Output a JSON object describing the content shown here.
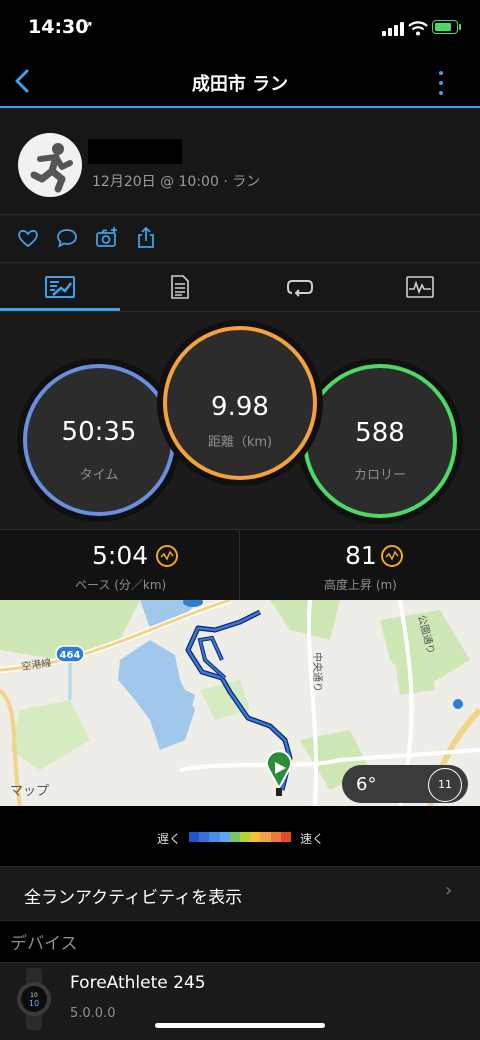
{
  "status": {
    "time": "14:30",
    "battery_pct": 0.85
  },
  "nav": {
    "title": "成田市 ラン"
  },
  "activity": {
    "meta": "12月20日 @ 10:00 · ラン",
    "icons": [
      "heart-icon",
      "comment-icon",
      "camera-add-icon",
      "share-icon"
    ]
  },
  "tabs": [
    "overview-tab-icon",
    "details-tab-icon",
    "laps-tab-icon",
    "charts-tab-icon"
  ],
  "rings": {
    "time": {
      "value": "50:35",
      "label": "タイム",
      "color": "#6a8fe0"
    },
    "distance": {
      "value": "9.98",
      "label": "距離（km)",
      "color": "#f5a23a"
    },
    "calories": {
      "value": "588",
      "label": "カロリー",
      "color": "#4cd964"
    }
  },
  "stats": {
    "pace": {
      "value": "5:04",
      "label": "ペース (分／km)"
    },
    "elevation": {
      "value": "81",
      "label": "高度上昇 (m)"
    }
  },
  "map": {
    "logo": "マップ",
    "road_badge": "464",
    "labels": [
      "空港線",
      "中央通り",
      "公園通り"
    ],
    "weather_temp": "6°",
    "wind_value": "11"
  },
  "legend": {
    "slow": "遅く",
    "fast": "速く",
    "colors": [
      "#2455c8",
      "#3a6fd8",
      "#4a8de8",
      "#5aa9f0",
      "#7cc36a",
      "#b8d23a",
      "#f1c233",
      "#f2a34a",
      "#ee7a3a",
      "#e24a2e"
    ]
  },
  "list": {
    "all_runs": "全ランアクティビティを表示",
    "section": "デバイス",
    "device_name": "ForeAthlete 245",
    "device_version": "5.0.0.0"
  }
}
